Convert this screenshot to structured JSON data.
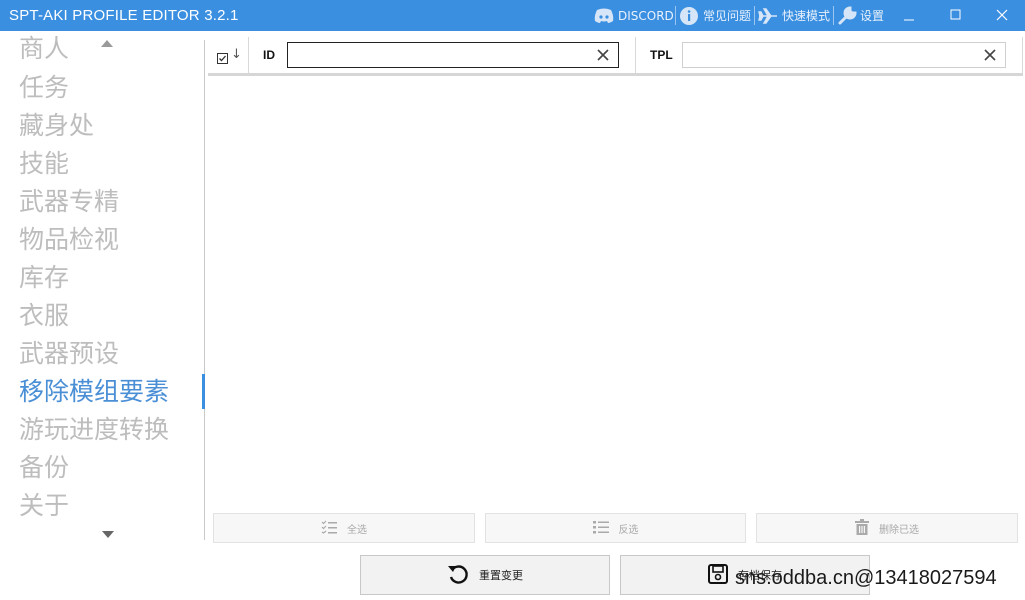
{
  "window": {
    "title": "SPT-AKI PROFILE EDITOR  3.2.1",
    "discord_label": "DISCORD",
    "faq_label": "常见问题",
    "quick_mode_label": "快速模式",
    "settings_label": "设置",
    "accent_color": "#3a8fe0"
  },
  "sidebar": {
    "items": [
      {
        "label": "商人"
      },
      {
        "label": "任务"
      },
      {
        "label": "藏身处"
      },
      {
        "label": "技能"
      },
      {
        "label": "武器专精"
      },
      {
        "label": "物品检视"
      },
      {
        "label": "库存"
      },
      {
        "label": "衣服"
      },
      {
        "label": "武器预设"
      },
      {
        "label": "移除模组要素"
      },
      {
        "label": "游玩进度转换"
      },
      {
        "label": "备份"
      },
      {
        "label": "关于"
      }
    ],
    "active_index": 9
  },
  "filter": {
    "id_label": "ID",
    "id_value": "",
    "tpl_label": "TPL",
    "tpl_value": ""
  },
  "actions": {
    "select_all": "全选",
    "invert": "反选",
    "delete_selected": "删除已选"
  },
  "bottom": {
    "reset_changes": "重置变更",
    "save_profile": "存档保存"
  },
  "watermark": "sns.oddba.cn@13418027594"
}
